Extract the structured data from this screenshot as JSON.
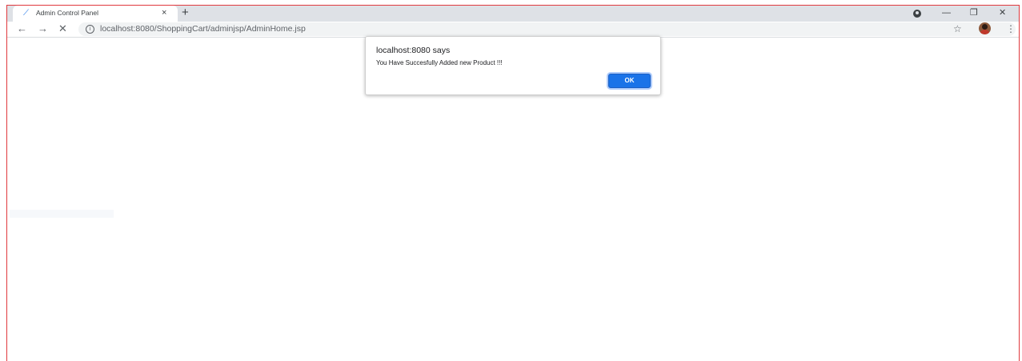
{
  "tab": {
    "title": "Admin Control Panel",
    "close": "×",
    "new_tab": "+"
  },
  "window": {
    "minimize": "—",
    "restore": "❐",
    "close": "✕"
  },
  "toolbar": {
    "back": "←",
    "forward": "→",
    "stop": "✕",
    "info": "i",
    "url": "localhost:8080/ShoppingCart/adminjsp/AdminHome.jsp",
    "star": "☆",
    "menu": "⋮"
  },
  "dialog": {
    "title": "localhost:8080 says",
    "message": "You Have Succesfully Added new Product !!!",
    "ok_label": "OK"
  },
  "colors": {
    "accent": "#1a73e8",
    "frame": "#e0393e",
    "tabstrip": "#dee1e6"
  }
}
